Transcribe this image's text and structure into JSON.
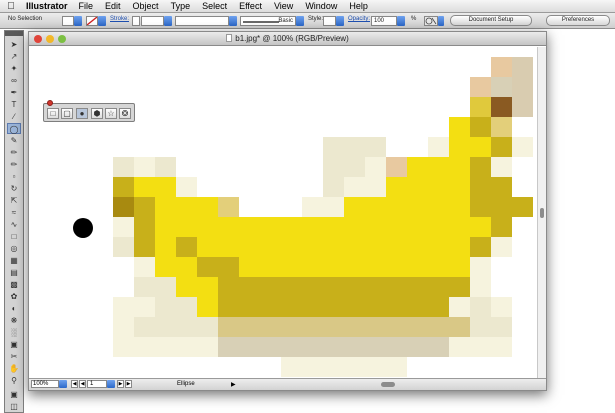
{
  "menubar": {
    "app_name": "Illustrator",
    "items": [
      "File",
      "Edit",
      "Object",
      "Type",
      "Select",
      "Effect",
      "View",
      "Window",
      "Help"
    ]
  },
  "controlbar": {
    "selection_label": "No Selection",
    "stroke_label": "Stroke:",
    "brush_value": "Basic",
    "style_label": "Style:",
    "opacity_label": "Opacity:",
    "opacity_value": "100",
    "opacity_unit": "%",
    "document_setup_label": "Document Setup",
    "preferences_label": "Preferences"
  },
  "document": {
    "title": "b1.jpg* @ 100% (RGB/Preview)",
    "zoom_value": "100%",
    "artboard_value": "1",
    "status_tool": "Ellipse"
  },
  "colors": {
    "traffic_red": "#e0443a",
    "traffic_yellow": "#f2b82a",
    "traffic_green": "#7cc043"
  },
  "shapes_palette": {
    "tools": [
      "rectangle-tool",
      "rounded-rectangle-tool",
      "ellipse-tool",
      "polygon-tool",
      "star-tool",
      "flare-tool"
    ],
    "active": "ellipse-tool"
  }
}
